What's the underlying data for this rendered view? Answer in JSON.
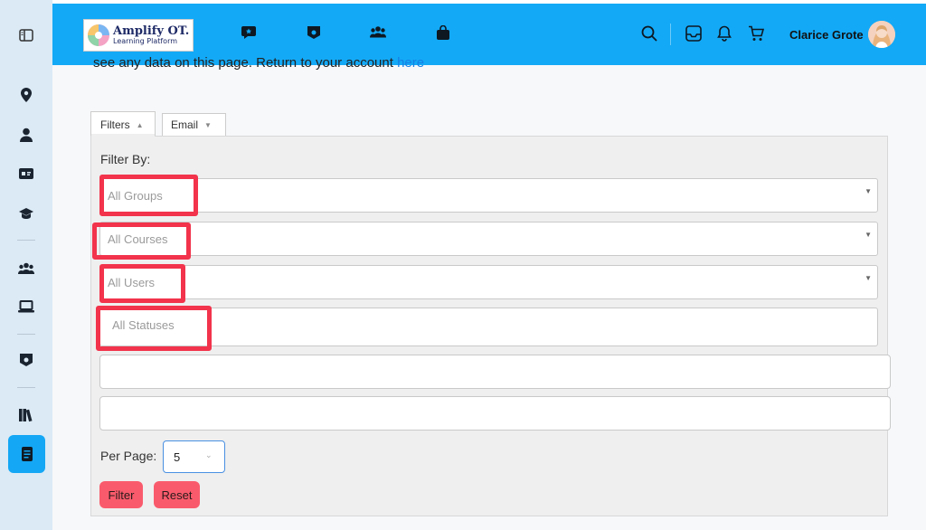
{
  "brand": {
    "title": "Amplify OT.",
    "subtitle": "Learning Platform",
    "accent": "#13a9f6",
    "highlight": "#f2334b",
    "button": "#f95b6c"
  },
  "topnav": {
    "icons": [
      "message-icon",
      "badge-icon",
      "users-icon",
      "bag-icon"
    ],
    "right_icons": [
      "search-icon",
      "inbox-icon",
      "bell-icon",
      "cart-icon"
    ],
    "user_name": "Clarice Grote"
  },
  "sidebar": {
    "icons": [
      "panel-toggle-icon",
      "location-icon",
      "user-icon",
      "id-card-icon",
      "graduation-icon",
      "group-icon",
      "laptop-icon",
      "badge-icon",
      "books-icon",
      "report-icon"
    ],
    "active": "report-icon"
  },
  "notice": {
    "text": "see any data on this page. Return to your account ",
    "link": "here"
  },
  "tabs": [
    {
      "label": "Filters"
    },
    {
      "label": "Email"
    }
  ],
  "filters": {
    "heading": "Filter By:",
    "groups_placeholder": "All Groups",
    "courses_placeholder": "All Courses",
    "users_placeholder": "All Users",
    "statuses_placeholder": "All Statuses",
    "per_page_label": "Per Page:",
    "per_page_value": "5",
    "filter_button": "Filter",
    "reset_button": "Reset"
  }
}
